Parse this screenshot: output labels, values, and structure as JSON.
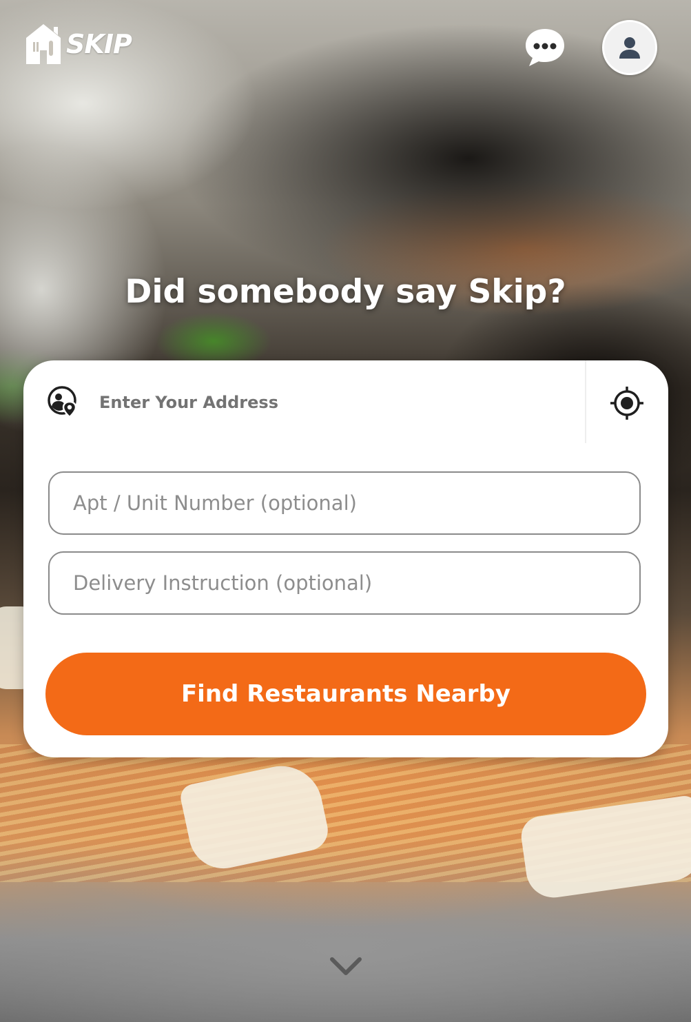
{
  "brand": {
    "logo_text": "SKIP",
    "accent_color": "#f36a17"
  },
  "header": {
    "chat_icon": "chat-bubble-icon",
    "account_icon": "user-icon"
  },
  "hero": {
    "headline": "Did somebody say Skip?"
  },
  "address_form": {
    "address_placeholder": "Enter Your Address",
    "address_icon": "address-pin-icon",
    "locate_icon": "crosshair-locate-icon",
    "apt_placeholder": "Apt / Unit Number (optional)",
    "instruction_placeholder": "Delivery Instruction (optional)",
    "submit_label": "Find Restaurants Nearby"
  },
  "footer": {
    "scroll_icon": "chevron-down-icon"
  }
}
